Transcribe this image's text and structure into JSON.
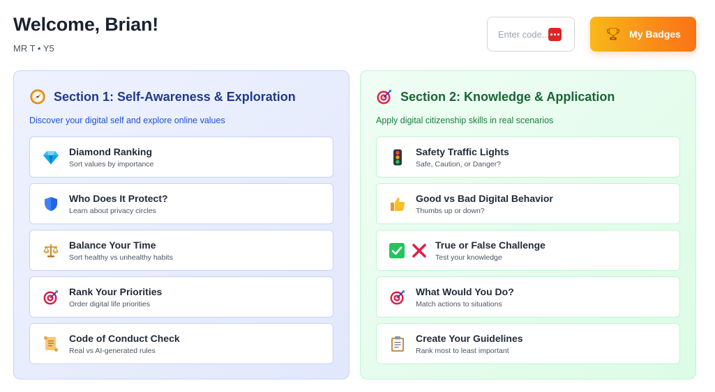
{
  "header": {
    "title": "Welcome, Brian!",
    "subtitle": "MR T • Y5"
  },
  "code_input": {
    "placeholder": "Enter code..."
  },
  "badges_button": {
    "label": "My Badges"
  },
  "sections": [
    {
      "title": "Section 1: Self-Awareness & Exploration",
      "description": "Discover your digital self and explore online values",
      "icon": "compass-icon",
      "items": [
        {
          "title": "Diamond Ranking",
          "subtitle": "Sort values by importance",
          "icon": "diamond-icon"
        },
        {
          "title": "Who Does It Protect?",
          "subtitle": "Learn about privacy circles",
          "icon": "shield-icon"
        },
        {
          "title": "Balance Your Time",
          "subtitle": "Sort healthy vs unhealthy habits",
          "icon": "scales-icon"
        },
        {
          "title": "Rank Your Priorities",
          "subtitle": "Order digital life priorities",
          "icon": "target-icon"
        },
        {
          "title": "Code of Conduct Check",
          "subtitle": "Real vs AI-generated rules",
          "icon": "scroll-icon"
        }
      ]
    },
    {
      "title": "Section 2: Knowledge & Application",
      "description": "Apply digital citizenship skills in real scenarios",
      "icon": "target-icon",
      "items": [
        {
          "title": "Safety Traffic Lights",
          "subtitle": "Safe, Caution, or Danger?",
          "icon": "traffic-light-icon"
        },
        {
          "title": "Good vs Bad Digital Behavior",
          "subtitle": "Thumbs up or down?",
          "icon": "thumbs-up-icon"
        },
        {
          "title": "True or False Challenge",
          "subtitle": "Test your knowledge",
          "icon": "check-and-cross-icons"
        },
        {
          "title": "What Would You Do?",
          "subtitle": "Match actions to situations",
          "icon": "target-icon"
        },
        {
          "title": "Create Your Guidelines",
          "subtitle": "Rank most to least important",
          "icon": "clipboard-icon"
        }
      ]
    }
  ],
  "colors": {
    "section_1_accent": "#1e3a8a",
    "section_2_accent": "#166534",
    "badges_gradient_start": "#f8b818",
    "badges_gradient_end": "#f97316"
  }
}
